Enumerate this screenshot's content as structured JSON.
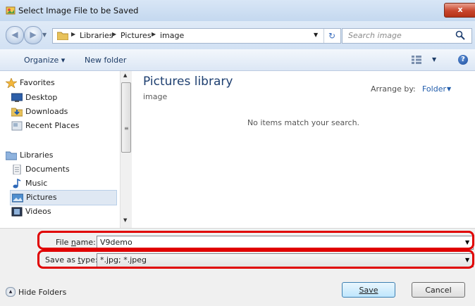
{
  "window": {
    "title": "Select Image File to be Saved",
    "close_label": "x"
  },
  "address": {
    "crumbs": [
      "Libraries",
      "Pictures",
      "image"
    ],
    "search_placeholder": "Search image"
  },
  "toolbar": {
    "organize_label": "Organize ▾",
    "new_folder_label": "New folder"
  },
  "sidebar": {
    "groups": [
      {
        "label": "Favorites",
        "icon": "star-icon",
        "items": [
          {
            "label": "Desktop",
            "icon": "desktop-icon"
          },
          {
            "label": "Downloads",
            "icon": "downloads-icon"
          },
          {
            "label": "Recent Places",
            "icon": "recent-places-icon"
          }
        ]
      },
      {
        "label": "Libraries",
        "icon": "libraries-icon",
        "items": [
          {
            "label": "Documents",
            "icon": "documents-icon"
          },
          {
            "label": "Music",
            "icon": "music-icon"
          },
          {
            "label": "Pictures",
            "icon": "pictures-icon",
            "selected": true
          },
          {
            "label": "Videos",
            "icon": "videos-icon"
          }
        ]
      }
    ]
  },
  "content": {
    "library_title": "Pictures library",
    "library_subtitle": "image",
    "arrange_label": "Arrange by:",
    "arrange_value": "Folder",
    "empty_message": "No items match your search."
  },
  "form": {
    "file_name_label_pre": "File ",
    "file_name_label_u": "n",
    "file_name_label_post": "ame:",
    "file_name_value": "V9demo",
    "save_type_label_pre": "Save as ",
    "save_type_label_u": "t",
    "save_type_label_post": "ype:",
    "save_type_value": "*.jpg; *.jpeg"
  },
  "footer": {
    "hide_folders_label": "Hide Folders",
    "save_label": "Save",
    "cancel_label": "Cancel"
  },
  "colors": {
    "highlight": "#e00000",
    "accent": "#1f5bab"
  }
}
